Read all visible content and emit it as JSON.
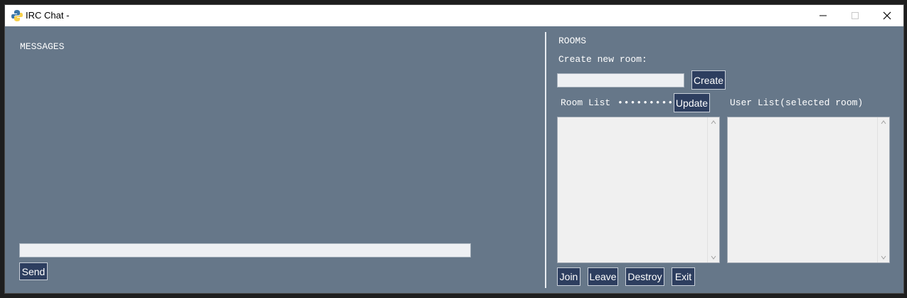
{
  "window": {
    "title": "IRC Chat -",
    "controls": {
      "minimize": "minimize-icon",
      "maximize": "maximize-icon",
      "close": "close-icon"
    }
  },
  "messages": {
    "heading": "MESSAGES",
    "input_value": "",
    "send_label": "Send"
  },
  "rooms": {
    "heading": "ROOMS",
    "create_label": "Create new room:",
    "create_input_value": "",
    "create_button": "Create",
    "room_list_label": "Room List",
    "room_list_dots": "•••••••••",
    "update_button": "Update",
    "user_list_label": "User List(selected room)",
    "room_list_items": [],
    "user_list_items": [],
    "join_button": "Join",
    "leave_button": "Leave",
    "destroy_button": "Destroy",
    "exit_button": "Exit"
  },
  "colors": {
    "window_bg": "#667789",
    "button_bg": "#2d3e5f",
    "input_bg": "#eef0f3"
  }
}
